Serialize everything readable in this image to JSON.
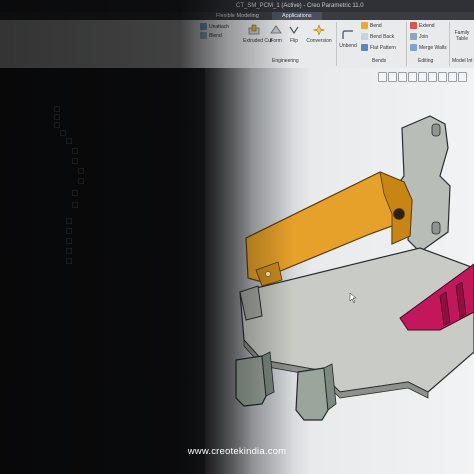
{
  "window": {
    "title": "CT_SM_PCM_1 (Active) - Creo Parametric 11.0"
  },
  "tabs": [
    {
      "label": "Flexible Modeling"
    },
    {
      "label": "Applications"
    }
  ],
  "ribbon": {
    "shapes": {
      "unattach": "Unattach",
      "blend": "Blend",
      "extruded_cut": "Extruded Cut",
      "form": "Form",
      "flip": "Flip",
      "conversion": "Conversion",
      "unbend": "Unbend"
    },
    "group_engineering": "Engineering",
    "bends_group": {
      "bend": "Bend",
      "bend_back": "Bend Back",
      "flat_pattern": "Flat Pattern",
      "label": "Bends"
    },
    "editing_group": {
      "extend": "Extend",
      "join": "Join",
      "merge_walls": "Merge Walls",
      "label": "Editing"
    },
    "model_intent": {
      "family_table": "Family Table",
      "label": "Model Int"
    }
  },
  "colors": {
    "orange_wall": "#e6a12a",
    "magenta_wall": "#c2185b",
    "part_gray": "#b9bdb8",
    "feet_gray": "#9aa69c"
  },
  "watermark": "www.creotekindia.com"
}
